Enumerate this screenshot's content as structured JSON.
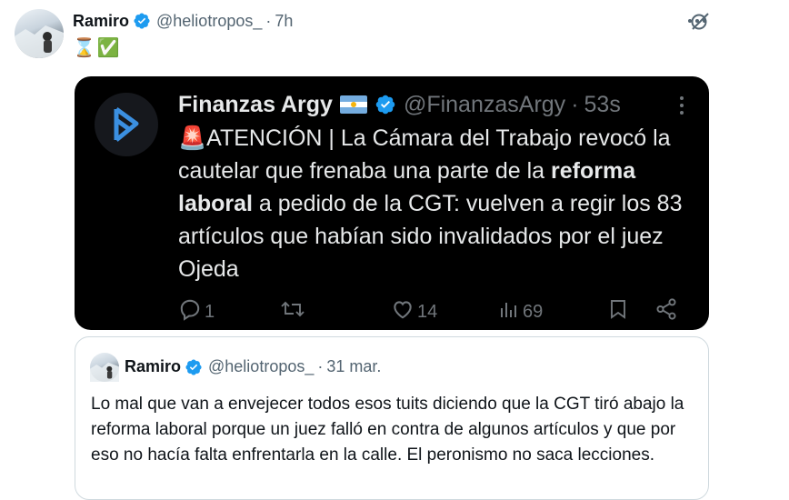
{
  "tweet": {
    "author_name": "Ramiro",
    "handle": "@heliotropos_",
    "separator": "·",
    "time": "7h",
    "body_emojis": [
      "⌛",
      "✅"
    ]
  },
  "embedded": {
    "author_name": "Finanzas Argy",
    "handle": "@FinanzasArgy",
    "separator": "·",
    "time": "53s",
    "alert_emoji": "🚨",
    "text_part1": "ATENCIÓN | La Cámara del Trabajo revocó la cautelar que frenaba una parte de la ",
    "text_bold": "reforma laboral",
    "text_part2": " a pedido de la CGT: vuelven a regir los 83 artículos que habían sido invalidados por el juez Ojeda",
    "replies": "1",
    "likes": "14",
    "views": "69"
  },
  "quote": {
    "author_name": "Ramiro",
    "handle": "@heliotropos_",
    "separator": "·",
    "date": "31 mar.",
    "text": "Lo mal que van a envejecer todos esos tuits diciendo que la CGT tiró abajo la reforma laboral porque un juez falló en contra de algunos artículos y que por eso no hacía falta enfrentarla en la calle. El peronismo no saca lecciones."
  },
  "colors": {
    "verified_blue": "#1d9bf0",
    "embed_background": "#000000",
    "secondary_text": "#536471"
  },
  "icons": [
    "grok-icon",
    "more-icon",
    "reply-icon",
    "retweet-icon",
    "like-icon",
    "views-icon",
    "bookmark-icon",
    "share-icon"
  ]
}
